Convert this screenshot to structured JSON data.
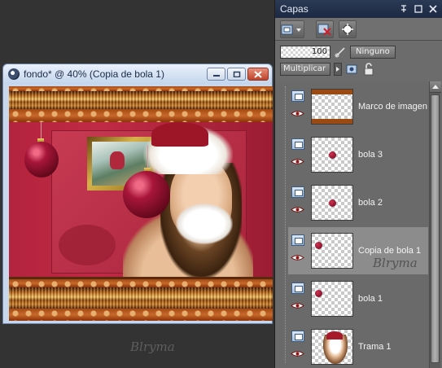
{
  "image_window": {
    "title": "fondo* @  40% (Copia de bola 1)",
    "buttons": [
      "minimize-icon",
      "maximize-icon",
      "close-icon"
    ]
  },
  "watermark": "Blryma",
  "palette": {
    "title": "Capas",
    "opacity": "100",
    "mask_label": "Ninguno",
    "blend_mode": "Multiplicar",
    "layers": [
      {
        "name": "Marco de imagen",
        "thumb": "frame"
      },
      {
        "name": "bola 3",
        "thumb": "dot-center"
      },
      {
        "name": "bola 2",
        "thumb": "dot-center"
      },
      {
        "name": "Copia de bola 1",
        "thumb": "dot-left",
        "selected": true
      },
      {
        "name": "bola 1",
        "thumb": "dot-left"
      },
      {
        "name": "Trama 1",
        "thumb": "portrait"
      }
    ]
  },
  "colors": {
    "desktop": "#333333",
    "palette_bg": "#6c6c6c",
    "selected_row": "#8c8c8c",
    "title_bar": "#1d2942"
  }
}
